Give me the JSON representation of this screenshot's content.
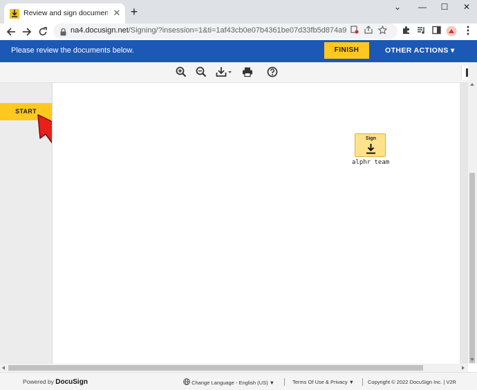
{
  "browser": {
    "tab_title": "Review and sign document(s) | D",
    "tab_close": "✕",
    "new_tab": "+",
    "url_host": "na4.docusign.net",
    "url_path": "/Signing/?insession=1&ti=1af43cb0e07b4361be07d33fb5d874a9",
    "controls": {
      "minimize": "⌄",
      "min": "—",
      "max": "☐",
      "close": "✕"
    }
  },
  "header": {
    "message": "Please review the documents below.",
    "finish_label": "FINISH",
    "other_actions_label": "OTHER ACTIONS ▾",
    "accent_color": "#ffc820",
    "bar_color": "#1c58b5"
  },
  "doc_toolbar": {
    "icons": [
      "zoom-in-icon",
      "zoom-out-icon",
      "download-icon",
      "print-icon",
      "help-icon",
      "page-view-icon"
    ]
  },
  "guide": {
    "start_label": "START"
  },
  "signature_field": {
    "label": "Sign",
    "signer": "alphr team"
  },
  "footer": {
    "powered_prefix": "Powered by",
    "powered_brand": "DocuSign",
    "language": "Change Language - English (US) ▼",
    "terms": "Terms Of Use & Privacy ▼",
    "copyright": "Copyright © 2022 DocuSign Inc. | V2R"
  }
}
